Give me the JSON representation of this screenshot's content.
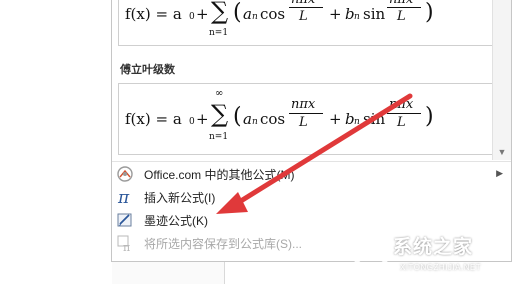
{
  "gallery": {
    "section_title": "傅立叶级数",
    "formula": {
      "lhs": "f(x) = a",
      "sub0": "0",
      "plus": " + ",
      "sum_top": "∞",
      "sum_symbol": "∑",
      "sum_bottom": "n=1",
      "a_term": "a",
      "a_sub": "n",
      "cos": "cos",
      "frac_num": "nπx",
      "frac_den": "L",
      "b_term": "b",
      "b_sub": "n",
      "sin": "sin",
      "open_paren": "(",
      "close_paren": ")"
    }
  },
  "menu": {
    "items": [
      {
        "label": "Office.com 中的其他公式(M)",
        "icon": "office-icon",
        "disabled": false,
        "submenu": true
      },
      {
        "label": "插入新公式(I)",
        "icon": "pi-icon",
        "disabled": false,
        "submenu": false
      },
      {
        "label": "墨迹公式(K)",
        "icon": "ink-equation-icon",
        "disabled": false,
        "submenu": false
      },
      {
        "label": "将所选内容保存到公式库(S)...",
        "icon": "save-to-gallery-icon",
        "disabled": true,
        "submenu": false
      }
    ]
  },
  "watermark": {
    "text": "系统之家",
    "url": "XITONGZHIJIA.NET"
  },
  "colors": {
    "arrow": "#e0393a",
    "accent": "#2b579a"
  }
}
